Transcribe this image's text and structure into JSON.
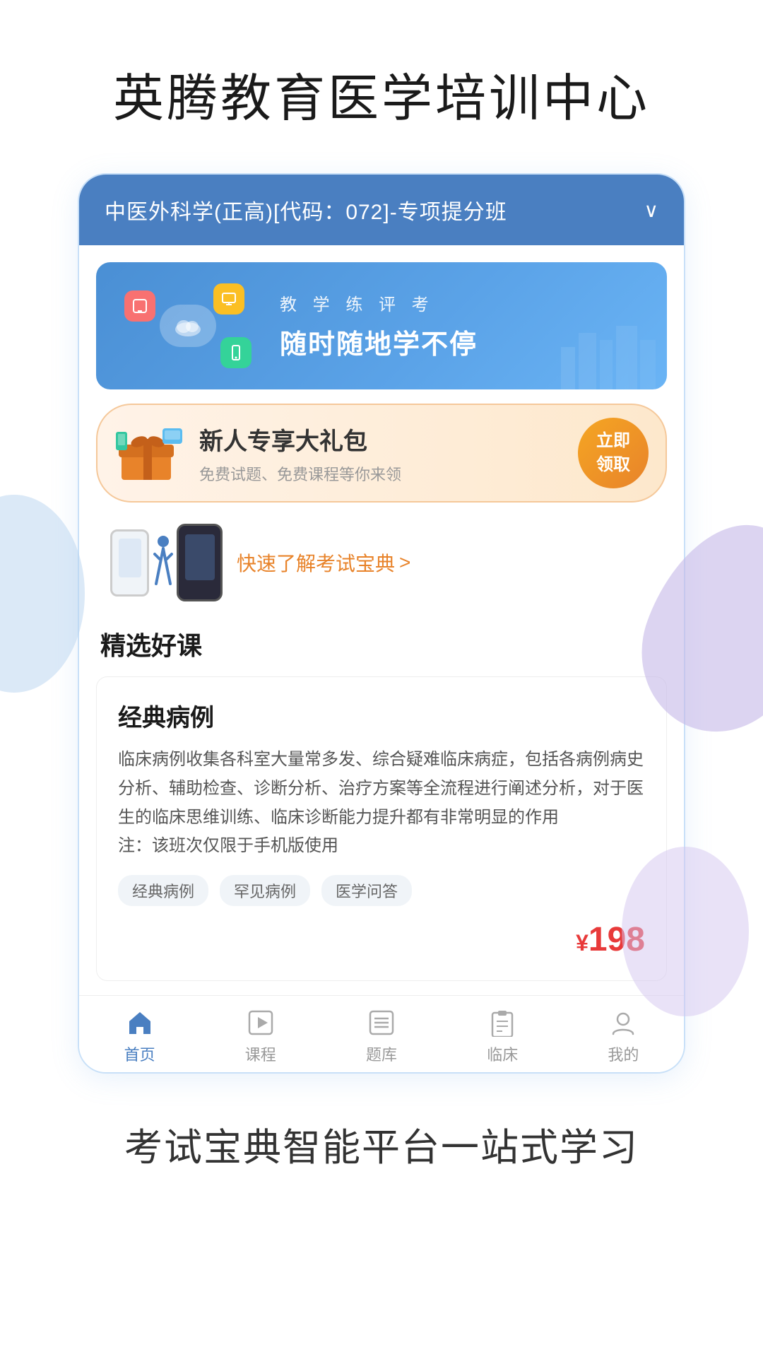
{
  "app": {
    "title": "英腾教育医学培训中心",
    "bottom_tagline": "考试宝典智能平台一站式学习"
  },
  "course_selector": {
    "label": "中医外科学(正高)[代码：072]-专项提分班",
    "arrow": "∨"
  },
  "banner": {
    "subtitle": "教 学 练 评 考",
    "title": "随时随地学不停"
  },
  "gift": {
    "title": "新人专享大礼包",
    "subtitle": "免费试题、免费课程等你来领",
    "button_line1": "立即",
    "button_line2": "领取"
  },
  "exam_promo": {
    "text": "快速了解考试宝典",
    "arrow": ">"
  },
  "sections": {
    "selected_courses_title": "精选好课"
  },
  "course_card": {
    "title": "经典病例",
    "description": "临床病例收集各科室大量常多发、综合疑难临床病症，包括各病例病史分析、辅助检查、诊断分析、治疗方案等全流程进行阐述分析，对于医生的临床思维训练、临床诊断能力提升都有非常明显的作用\n注：该班次仅限于手机版使用",
    "tags": [
      "经典病例",
      "罕见病例",
      "医学问答"
    ],
    "price": "198",
    "price_symbol": "¥"
  },
  "bottom_nav": {
    "items": [
      {
        "label": "首页",
        "icon": "home",
        "active": true
      },
      {
        "label": "课程",
        "icon": "play",
        "active": false
      },
      {
        "label": "题库",
        "icon": "list",
        "active": false
      },
      {
        "label": "临床",
        "icon": "clipboard",
        "active": false
      },
      {
        "label": "我的",
        "icon": "user",
        "active": false
      }
    ]
  },
  "colors": {
    "primary": "#4a7fc1",
    "accent_orange": "#e8832a",
    "price_red": "#e83a3a",
    "tag_bg": "#f0f4f8"
  }
}
